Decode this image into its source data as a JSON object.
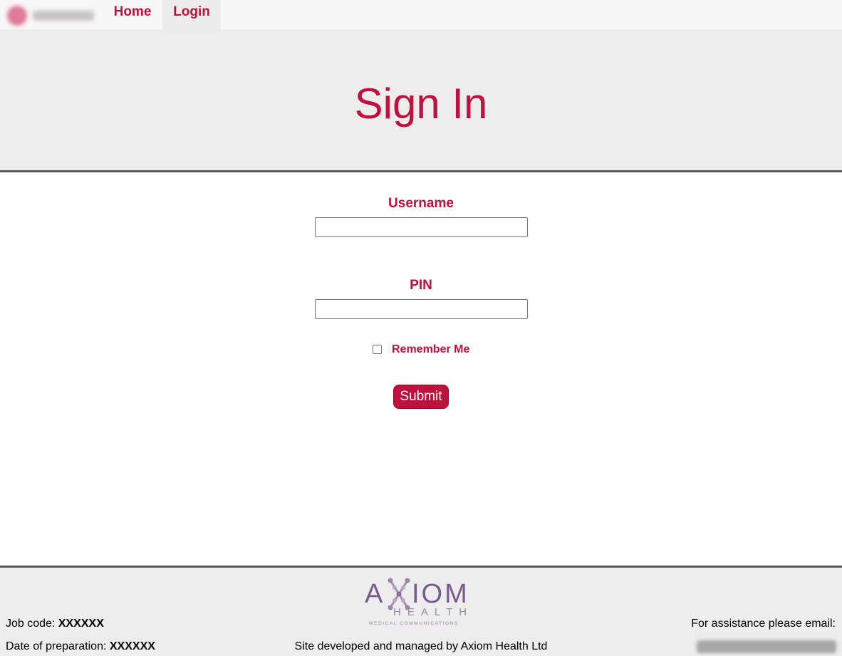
{
  "nav": {
    "items": [
      {
        "label": "Home"
      },
      {
        "label": "Login"
      }
    ]
  },
  "hero": {
    "title": "Sign In"
  },
  "form": {
    "username_label": "Username",
    "username_value": "",
    "pin_label": "PIN",
    "pin_value": "",
    "remember_label": "Remember Me",
    "remember_checked": false,
    "submit_label": "Submit"
  },
  "footer": {
    "job_code_label": "Job code: ",
    "job_code_value": "XXXXXX",
    "prep_label": "Date of preparation: ",
    "prep_value": "XXXXXX",
    "developed_text": "Site developed and managed by Axiom Health Ltd",
    "assistance_text": "For assistance please email:",
    "logo": {
      "wordmark_left": "A",
      "wordmark_right": "IOM",
      "sub": "HEALTH",
      "tagline": "MEDICAL COMMUNICATIONS"
    }
  },
  "colors": {
    "accent": "#c0103c",
    "hero_bg": "#ededed",
    "rule": "#5a5a5a",
    "logo_purple": "#7a5b8e"
  }
}
